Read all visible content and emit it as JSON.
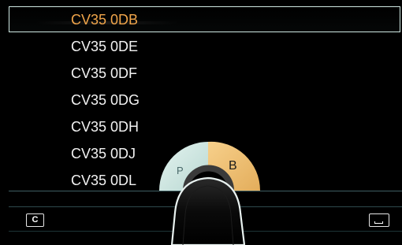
{
  "list": {
    "items": [
      {
        "label": "CV35 0DB",
        "selected": true
      },
      {
        "label": "CV35 0DE",
        "selected": false
      },
      {
        "label": "CV35 0DF",
        "selected": false
      },
      {
        "label": "CV35 0DG",
        "selected": false
      },
      {
        "label": "CV35 0DH",
        "selected": false
      },
      {
        "label": "CV35 0DJ",
        "selected": false
      },
      {
        "label": "CV35 0DL",
        "selected": false
      }
    ]
  },
  "dial": {
    "left_label": "P",
    "right_label": "B",
    "left_color": "#cfe8e3",
    "right_color": "#f2c47a"
  },
  "keys": {
    "clear_label": "C",
    "space_icon": "space-bar-icon"
  },
  "colors": {
    "selected_text": "#f0a54a",
    "list_text": "#f2f2f2",
    "frame": "#cfe8e3",
    "background": "#000000"
  }
}
